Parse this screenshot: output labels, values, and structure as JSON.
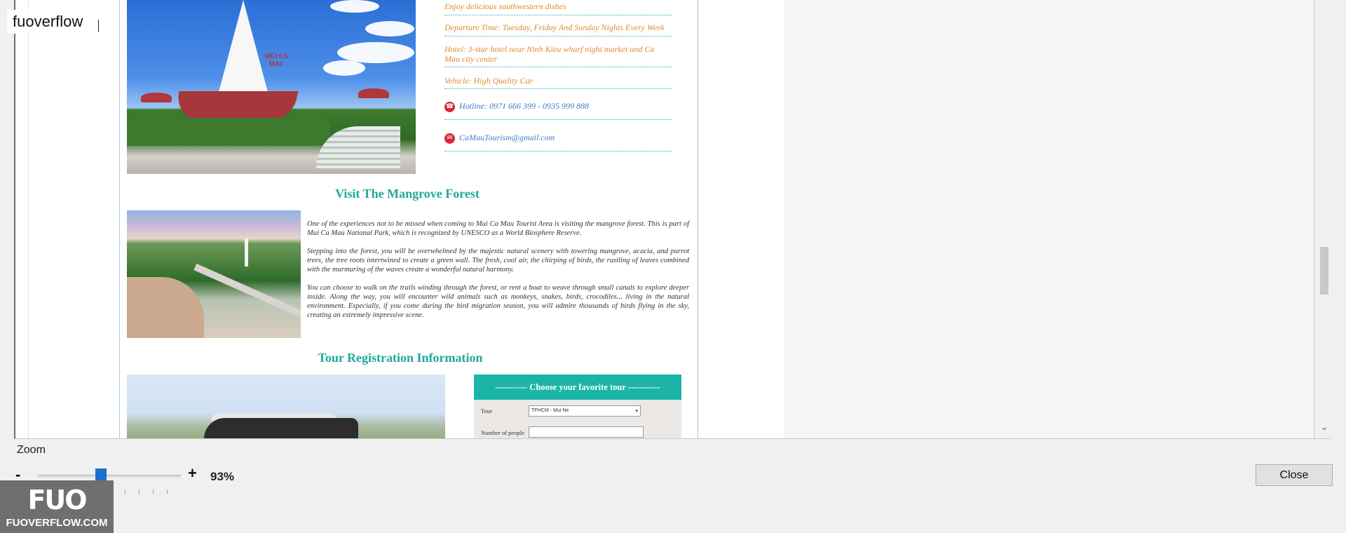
{
  "overlay": {
    "badge": "fuoverflow"
  },
  "document": {
    "info_rows": [
      {
        "text": "Enjoy delicious southwestern dishes",
        "style": "orange",
        "icon": ""
      },
      {
        "text": "Departure Time: Tuesday, Friday And Sunday Nights Every Week",
        "style": "orange",
        "icon": ""
      },
      {
        "text": "Hotel: 3-star hotel near Ninh Kieu wharf night market and Ca Mau city center",
        "style": "orange",
        "icon": ""
      },
      {
        "text": "Vehicle: High Quality Car",
        "style": "orange",
        "icon": ""
      },
      {
        "text": "Hotline: 0971 666 399 - 0935 999 888",
        "style": "blue",
        "icon": "phone-icon"
      },
      {
        "text": "CaMauTourism@gmail.com",
        "style": "blue",
        "icon": "mail-icon"
      }
    ],
    "hero_sign": "MŨI CÀ MAU",
    "mangrove_title": "Visit The Mangrove Forest",
    "paragraphs": [
      "One of the experiences not to be missed when coming to Mui Ca Mau Tourist Area is visiting the mangrove forest. This is part of Mui Ca Mau National Park, which is recognized by UNESCO as a World Biosphere Reserve.",
      "Stepping into the forest, you will be overwhelmed by the majestic natural scenery with towering mangrove, acacia, and parrot trees, the tree roots intertwined to create a green wall. The fresh, cool air, the chirping of birds, the rustling of leaves combined with the murmuring of the waves create a wonderful natural harmony.",
      "You can choose to walk on the trails winding through the forest, or rent a boat to weave through small canals to explore deeper inside. Along the way, you will encounter wild animals such as monkeys, snakes, birds, crocodiles... living in the natural environment. Especially, if you come during the bird migration season, you will admire thousands of birds flying in the sky, creating an extremely impressive scene."
    ],
    "registration_title": "Tour Registration Information",
    "form": {
      "header": "----------- Choose your favorite tour -----------",
      "tour_label": "Tour",
      "tour_value": "TPHCM - Mui Ne",
      "people_label": "Number of people"
    }
  },
  "zoom": {
    "label": "Zoom",
    "minus": "-",
    "plus": "+",
    "value": "93%",
    "level_percent": 93
  },
  "buttons": {
    "close": "Close"
  },
  "watermark": {
    "mark": "FUO",
    "text": "FUOVERFLOW.COM"
  },
  "colors": {
    "accent": "#1bb5a8",
    "title_teal": "#1fa89b",
    "orange_text": "#e08a2d",
    "blue_text": "#3f7cc0",
    "slider": "#1b6fd1"
  }
}
